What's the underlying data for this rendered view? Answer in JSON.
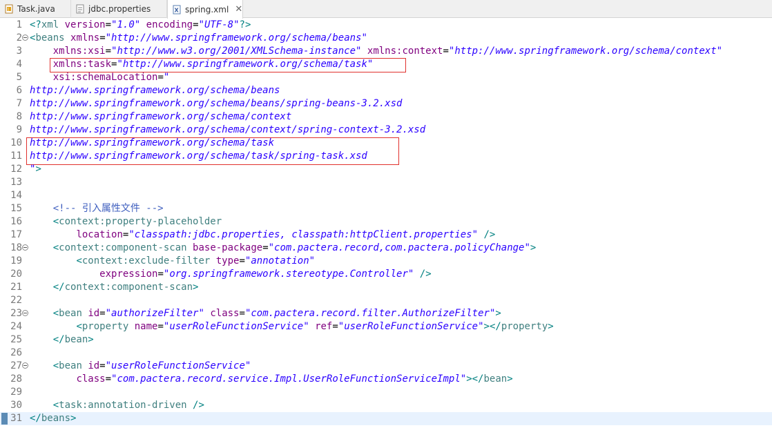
{
  "tabs": [
    {
      "label": "Task.java",
      "icon": "java-file-icon",
      "active": false
    },
    {
      "label": "jdbc.properties",
      "icon": "properties-file-icon",
      "active": false
    },
    {
      "label": "spring.xml",
      "icon": "xml-file-icon",
      "active": true,
      "close": "✕"
    }
  ],
  "lines": [
    {
      "n": "1",
      "fold": false,
      "tokens": [
        [
          "pun",
          "<?"
        ],
        [
          "tag",
          "xml"
        ],
        [
          "txt",
          " "
        ],
        [
          "attr",
          "version"
        ],
        [
          "txt",
          "="
        ],
        [
          "val",
          "\"1.0\""
        ],
        [
          "txt",
          " "
        ],
        [
          "attr",
          "encoding"
        ],
        [
          "txt",
          "="
        ],
        [
          "val",
          "\"UTF-8\""
        ],
        [
          "pun",
          "?>"
        ]
      ]
    },
    {
      "n": "2",
      "fold": true,
      "tokens": [
        [
          "pun",
          "<"
        ],
        [
          "tag",
          "beans"
        ],
        [
          "txt",
          " "
        ],
        [
          "attr",
          "xmlns"
        ],
        [
          "txt",
          "="
        ],
        [
          "val",
          "\"http://www.springframework.org/schema/beans\""
        ]
      ]
    },
    {
      "n": "3",
      "fold": false,
      "tokens": [
        [
          "txt",
          "    "
        ],
        [
          "attr",
          "xmlns:xsi"
        ],
        [
          "txt",
          "="
        ],
        [
          "val",
          "\"http://www.w3.org/2001/XMLSchema-instance\""
        ],
        [
          "txt",
          " "
        ],
        [
          "attr",
          "xmlns:context"
        ],
        [
          "txt",
          "="
        ],
        [
          "val",
          "\"http://www.springframework.org/schema/context\""
        ]
      ]
    },
    {
      "n": "4",
      "fold": false,
      "tokens": [
        [
          "txt",
          "    "
        ],
        [
          "attr",
          "xmlns:task"
        ],
        [
          "txt",
          "="
        ],
        [
          "val",
          "\"http://www.springframework.org/schema/task\""
        ]
      ]
    },
    {
      "n": "5",
      "fold": false,
      "tokens": [
        [
          "txt",
          "    "
        ],
        [
          "attr",
          "xsi:schemaLocation"
        ],
        [
          "txt",
          "="
        ],
        [
          "val",
          "\""
        ]
      ]
    },
    {
      "n": "6",
      "fold": false,
      "tokens": [
        [
          "val",
          "http://www.springframework.org/schema/beans"
        ]
      ]
    },
    {
      "n": "7",
      "fold": false,
      "tokens": [
        [
          "val",
          "http://www.springframework.org/schema/beans/spring-beans-3.2.xsd"
        ]
      ]
    },
    {
      "n": "8",
      "fold": false,
      "tokens": [
        [
          "val",
          "http://www.springframework.org/schema/context"
        ]
      ]
    },
    {
      "n": "9",
      "fold": false,
      "tokens": [
        [
          "val",
          "http://www.springframework.org/schema/context/spring-context-3.2.xsd"
        ]
      ]
    },
    {
      "n": "10",
      "fold": false,
      "tokens": [
        [
          "val",
          "http://www.springframework.org/schema/task"
        ]
      ]
    },
    {
      "n": "11",
      "fold": false,
      "tokens": [
        [
          "val",
          "http://www.springframework.org/schema/task/spring-task.xsd"
        ]
      ]
    },
    {
      "n": "12",
      "fold": false,
      "tokens": [
        [
          "val",
          "\""
        ],
        [
          "pun",
          ">"
        ]
      ]
    },
    {
      "n": "13",
      "fold": false,
      "tokens": []
    },
    {
      "n": "14",
      "fold": false,
      "tokens": []
    },
    {
      "n": "15",
      "fold": false,
      "tokens": [
        [
          "txt",
          "    "
        ],
        [
          "com",
          "<!-- 引入属性文件 -->"
        ]
      ]
    },
    {
      "n": "16",
      "fold": false,
      "tokens": [
        [
          "txt",
          "    "
        ],
        [
          "pun",
          "<"
        ],
        [
          "tag",
          "context:property-placeholder"
        ]
      ]
    },
    {
      "n": "17",
      "fold": false,
      "tokens": [
        [
          "txt",
          "        "
        ],
        [
          "attr",
          "location"
        ],
        [
          "txt",
          "="
        ],
        [
          "val",
          "\"classpath:jdbc.properties, classpath:httpClient.properties\""
        ],
        [
          "txt",
          " "
        ],
        [
          "pun",
          "/>"
        ]
      ]
    },
    {
      "n": "18",
      "fold": true,
      "tokens": [
        [
          "txt",
          "    "
        ],
        [
          "pun",
          "<"
        ],
        [
          "tag",
          "context:component-scan"
        ],
        [
          "txt",
          " "
        ],
        [
          "attr",
          "base-package"
        ],
        [
          "txt",
          "="
        ],
        [
          "val",
          "\"com.pactera.record,com.pactera.policyChange\""
        ],
        [
          "pun",
          ">"
        ]
      ]
    },
    {
      "n": "19",
      "fold": false,
      "tokens": [
        [
          "txt",
          "        "
        ],
        [
          "pun",
          "<"
        ],
        [
          "tag",
          "context:exclude-filter"
        ],
        [
          "txt",
          " "
        ],
        [
          "attr",
          "type"
        ],
        [
          "txt",
          "="
        ],
        [
          "val",
          "\"annotation\""
        ]
      ]
    },
    {
      "n": "20",
      "fold": false,
      "tokens": [
        [
          "txt",
          "            "
        ],
        [
          "attr",
          "expression"
        ],
        [
          "txt",
          "="
        ],
        [
          "val",
          "\"org.springframework.stereotype.Controller\""
        ],
        [
          "txt",
          " "
        ],
        [
          "pun",
          "/>"
        ]
      ]
    },
    {
      "n": "21",
      "fold": false,
      "tokens": [
        [
          "txt",
          "    "
        ],
        [
          "pun",
          "</"
        ],
        [
          "tag",
          "context:component-scan"
        ],
        [
          "pun",
          ">"
        ]
      ]
    },
    {
      "n": "22",
      "fold": false,
      "tokens": []
    },
    {
      "n": "23",
      "fold": true,
      "tokens": [
        [
          "txt",
          "    "
        ],
        [
          "pun",
          "<"
        ],
        [
          "tag",
          "bean"
        ],
        [
          "txt",
          " "
        ],
        [
          "attr",
          "id"
        ],
        [
          "txt",
          "="
        ],
        [
          "val",
          "\"authorizeFilter\""
        ],
        [
          "txt",
          " "
        ],
        [
          "attr",
          "class"
        ],
        [
          "txt",
          "="
        ],
        [
          "val",
          "\"com.pactera.record.filter.AuthorizeFilter\""
        ],
        [
          "pun",
          ">"
        ]
      ]
    },
    {
      "n": "24",
      "fold": false,
      "tokens": [
        [
          "txt",
          "        "
        ],
        [
          "pun",
          "<"
        ],
        [
          "tag",
          "property"
        ],
        [
          "txt",
          " "
        ],
        [
          "attr",
          "name"
        ],
        [
          "txt",
          "="
        ],
        [
          "val",
          "\"userRoleFunctionService\""
        ],
        [
          "txt",
          " "
        ],
        [
          "attr",
          "ref"
        ],
        [
          "txt",
          "="
        ],
        [
          "val",
          "\"userRoleFunctionService\""
        ],
        [
          "pun",
          "></"
        ],
        [
          "tag",
          "property"
        ],
        [
          "pun",
          ">"
        ]
      ]
    },
    {
      "n": "25",
      "fold": false,
      "tokens": [
        [
          "txt",
          "    "
        ],
        [
          "pun",
          "</"
        ],
        [
          "tag",
          "bean"
        ],
        [
          "pun",
          ">"
        ]
      ]
    },
    {
      "n": "26",
      "fold": false,
      "tokens": []
    },
    {
      "n": "27",
      "fold": true,
      "tokens": [
        [
          "txt",
          "    "
        ],
        [
          "pun",
          "<"
        ],
        [
          "tag",
          "bean"
        ],
        [
          "txt",
          " "
        ],
        [
          "attr",
          "id"
        ],
        [
          "txt",
          "="
        ],
        [
          "val",
          "\"userRoleFunctionService\""
        ]
      ]
    },
    {
      "n": "28",
      "fold": false,
      "tokens": [
        [
          "txt",
          "        "
        ],
        [
          "attr",
          "class"
        ],
        [
          "txt",
          "="
        ],
        [
          "val",
          "\"com.pactera.record.service.Impl.UserRoleFunctionServiceImpl\""
        ],
        [
          "pun",
          "></"
        ],
        [
          "tag",
          "bean"
        ],
        [
          "pun",
          ">"
        ]
      ]
    },
    {
      "n": "29",
      "fold": false,
      "tokens": []
    },
    {
      "n": "30",
      "fold": false,
      "tokens": [
        [
          "txt",
          "    "
        ],
        [
          "pun",
          "<"
        ],
        [
          "tag",
          "task:annotation-driven"
        ],
        [
          "txt",
          " "
        ],
        [
          "pun",
          "/>"
        ]
      ]
    },
    {
      "n": "31",
      "fold": false,
      "current": true,
      "tokens": [
        [
          "pun",
          "</"
        ],
        [
          "tag",
          "beans"
        ],
        [
          "pun",
          ">"
        ]
      ]
    }
  ],
  "colors": {
    "tag": "#3f7f7f",
    "attribute": "#7f007f",
    "value": "#2a00ff",
    "comment": "#3f5fbf",
    "highlight_box": "#e0302c",
    "current_line": "#e8f2fe"
  }
}
